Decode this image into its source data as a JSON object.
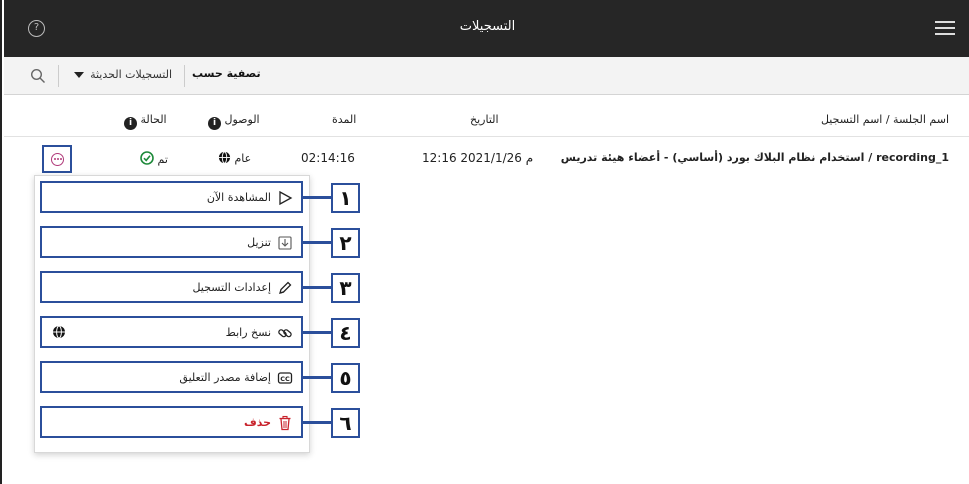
{
  "header": {
    "title": "التسجيلات",
    "help_glyph": "?"
  },
  "filter": {
    "label": "تصفية حسب",
    "selected": "التسجيلات الحديثة"
  },
  "columns": {
    "name": "اسم الجلسة / اسم التسجيل",
    "date": "التاريخ",
    "duration": "المدة",
    "access": "الوصول",
    "status": "الحالة",
    "info_glyph": "i"
  },
  "row": {
    "name": "استخدام نظام البلاك بورد (أساسي) - أعضاء هيئة تدريس / recording_1",
    "date": "12:16 2021/1/26 م",
    "duration": "02:14:16",
    "access": "عام",
    "status": "تم"
  },
  "menu": [
    {
      "label": "المشاهدة الآن",
      "icon": "play-icon",
      "num": "١"
    },
    {
      "label": "تنزيل",
      "icon": "download-icon",
      "num": "٢"
    },
    {
      "label": "إعدادات التسجيل",
      "icon": "pencil-icon",
      "num": "٣"
    },
    {
      "label": "نسخ رابط",
      "icon": "link-icon",
      "num": "٤"
    },
    {
      "label": "إضافة مصدر التعليق",
      "icon": "cc-icon",
      "num": "٥"
    },
    {
      "label": "حذف",
      "icon": "trash-icon",
      "num": "٦"
    }
  ],
  "colors": {
    "accent": "#2b4f9b",
    "danger": "#c8232c",
    "success": "#1e8a3a",
    "header_bg": "#262626"
  }
}
